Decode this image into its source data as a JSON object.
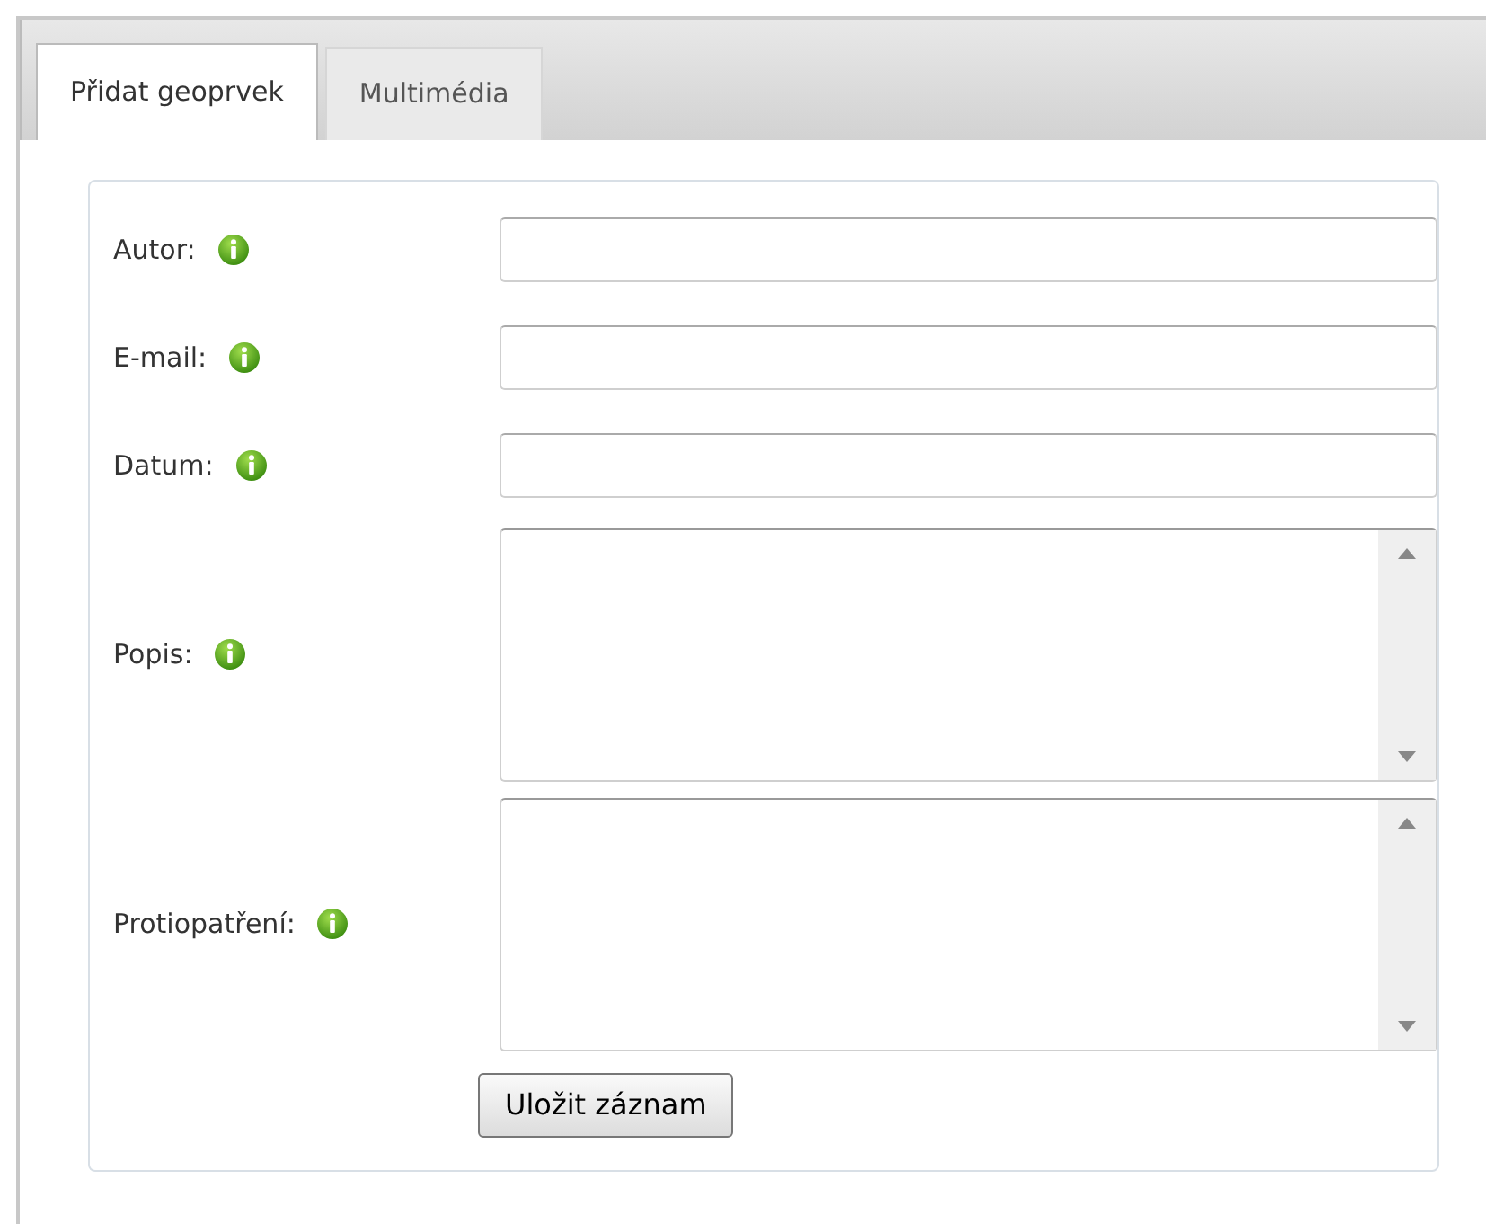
{
  "tabs": [
    {
      "label": "Přidat geoprvek",
      "selected": true
    },
    {
      "label": "Multimédia",
      "selected": false
    }
  ],
  "form": {
    "fields": [
      {
        "label": "Autor:",
        "kind": "input"
      },
      {
        "label": "E-mail:",
        "kind": "input"
      },
      {
        "label": "Datum:",
        "kind": "input"
      },
      {
        "label": "Popis:",
        "kind": "textarea"
      },
      {
        "label": "Protiopatření:",
        "kind": "textarea"
      }
    ],
    "submit": "Uložit záznam"
  }
}
